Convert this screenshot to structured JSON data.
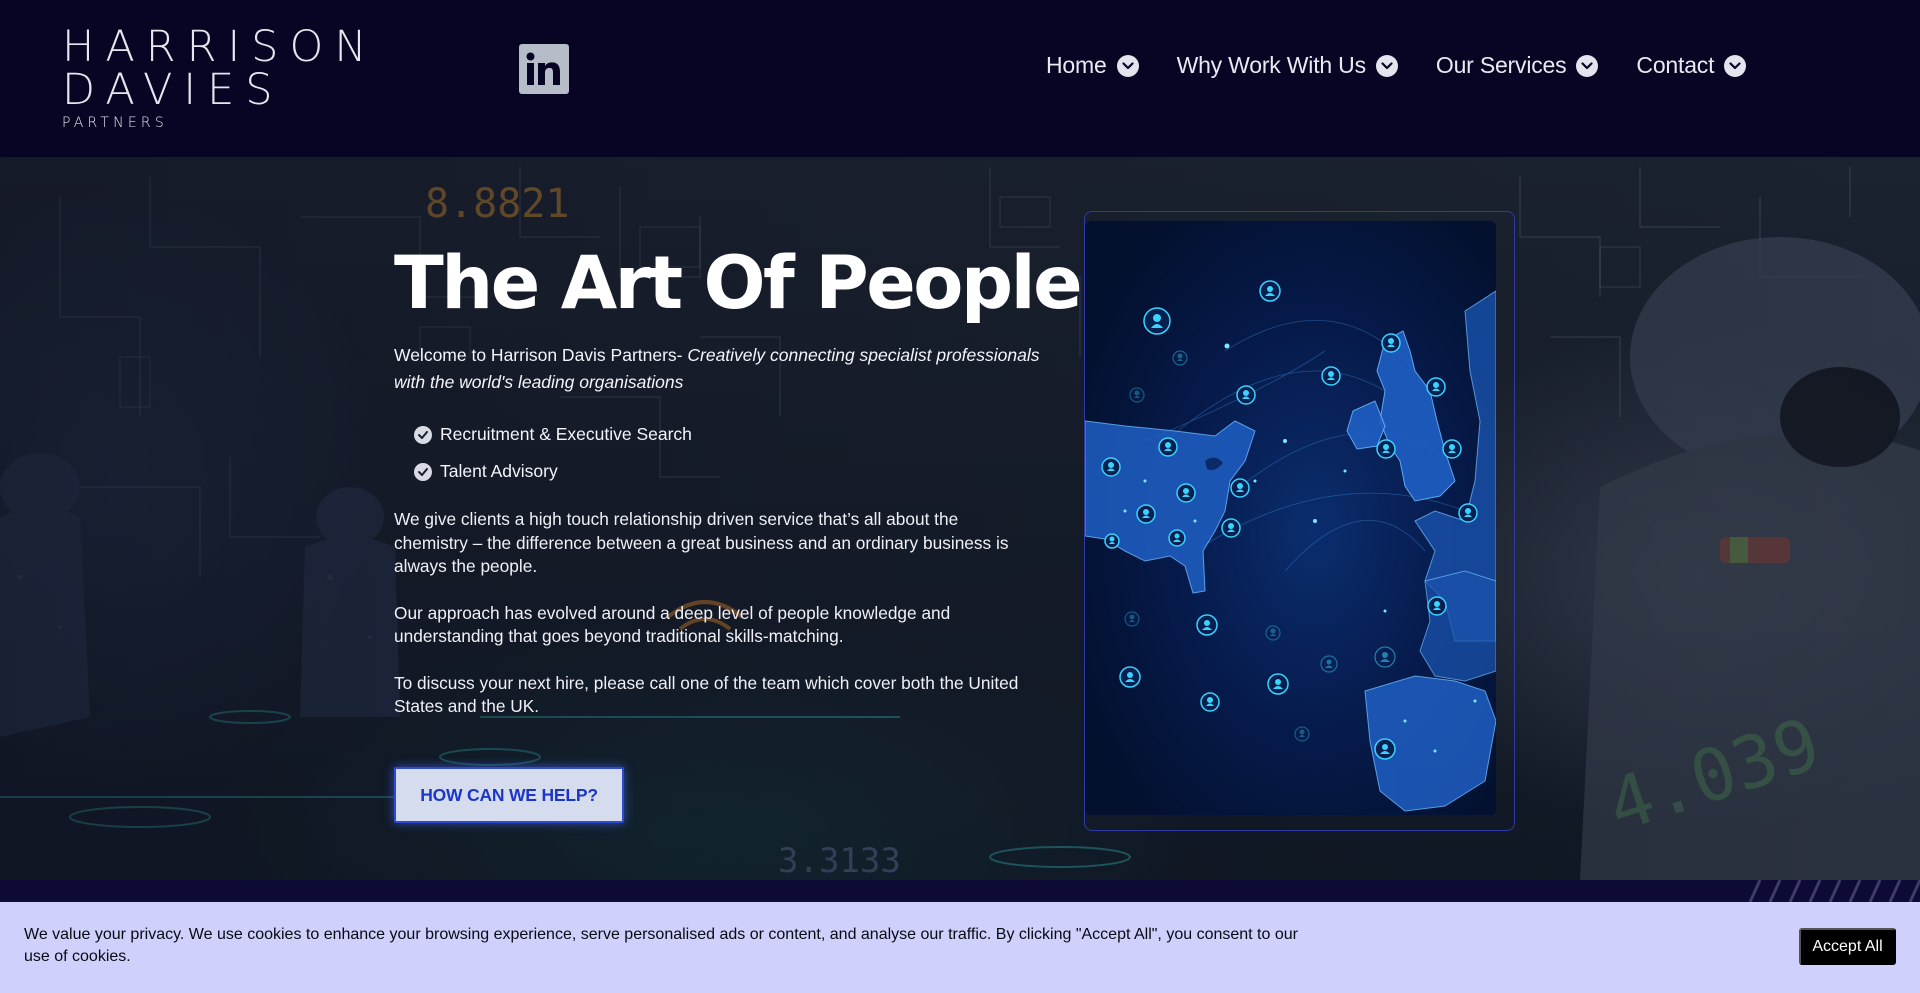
{
  "brand": {
    "logo_line1": "HARRISON",
    "logo_line2": "DAVIES",
    "logo_line3": "PARTNERS"
  },
  "social": {
    "icon": "linkedin-icon"
  },
  "nav": {
    "items": [
      {
        "label": "Home"
      },
      {
        "label": "Why Work With Us"
      },
      {
        "label": "Our Services"
      },
      {
        "label": "Contact"
      }
    ]
  },
  "hero": {
    "title": "The Art Of People",
    "intro_plain": "Welcome to Harrison Davis Partners- ",
    "intro_italic": "Creatively connecting specialist professionals with the world's leading organisations",
    "checklist": [
      "Recruitment & Executive Search",
      "Talent Advisory"
    ],
    "paragraphs": [
      "We give clients a high touch relationship driven service that’s all about the chemistry – the difference between a great business and an ordinary business is always the people.",
      "Our approach has evolved around a deep level of people knowledge and understanding that goes beyond traditional skills-matching.",
      "To discuss your next hire, please call one of the team which cover both the United States and the UK."
    ],
    "cta_label": "HOW CAN WE HELP?",
    "background_numbers": [
      "8.8821",
      "3.3133",
      "4.039"
    ]
  },
  "cookie": {
    "text": "We value your privacy. We use cookies to enhance your browsing experience, serve personalised ads or content, and analyse our traffic. By clicking \"Accept All\", you consent to our use of cookies.",
    "accept_label": "Accept All"
  },
  "colors": {
    "header_bg": "#070523",
    "cookie_bg": "#cfd0fb",
    "cta_text": "#1d36c9",
    "map_accent": "#3ad6ff"
  }
}
